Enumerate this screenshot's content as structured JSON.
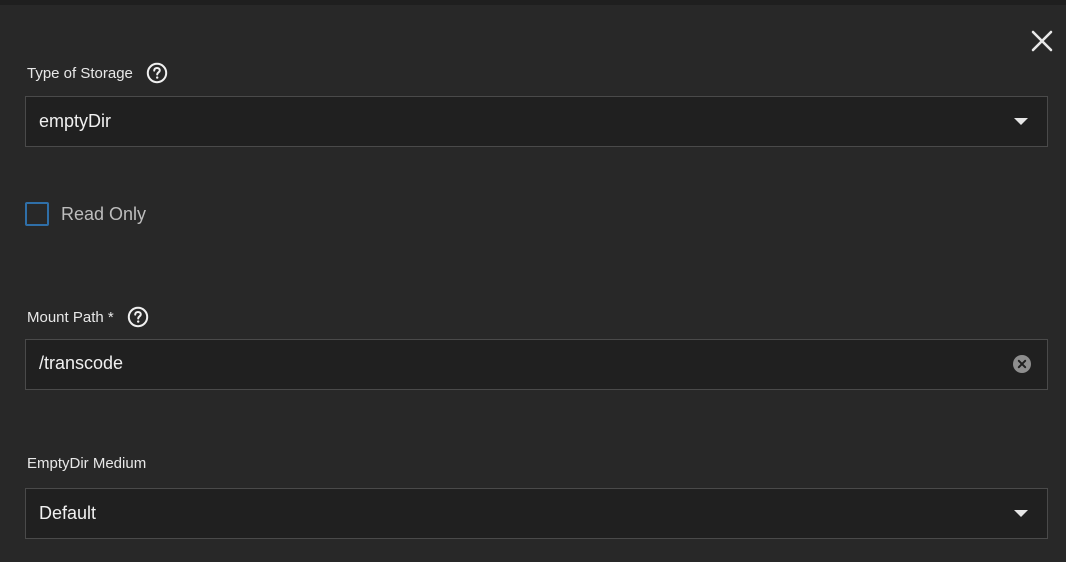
{
  "icons": {
    "close": "close-icon",
    "help": "help-icon",
    "dropdown": "chevron-down-icon",
    "clear": "clear-circle-icon"
  },
  "colors": {
    "background": "#282828",
    "field_background": "#202020",
    "border": "#4a4a4a",
    "checkbox_border": "#2f6fa8"
  },
  "storage_type": {
    "label": "Type of Storage",
    "value": "emptyDir"
  },
  "read_only": {
    "label": "Read Only",
    "checked": false
  },
  "mount_path": {
    "label": "Mount Path *",
    "value": "/transcode"
  },
  "empty_dir_medium": {
    "label": "EmptyDir Medium",
    "value": "Default"
  }
}
